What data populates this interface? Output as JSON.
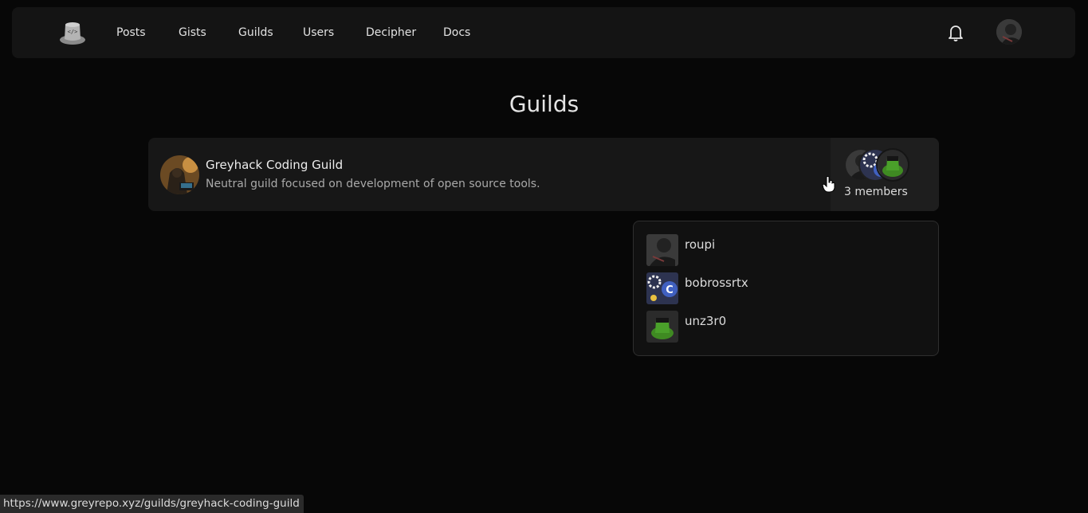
{
  "nav": {
    "links": [
      "Posts",
      "Gists",
      "Guilds",
      "Users",
      "Decipher",
      "Docs"
    ],
    "logo_icon": "hat-logo-icon",
    "bell_icon": "bell-icon"
  },
  "page": {
    "title": "Guilds"
  },
  "guild": {
    "name": "Greyhack Coding Guild",
    "description": "Neutral guild focused on development of open source tools.",
    "members_label": "3 members"
  },
  "members": [
    {
      "name": "roupi"
    },
    {
      "name": "bobrossrtx"
    },
    {
      "name": "unz3r0"
    }
  ],
  "status_bar": {
    "url": "https://www.greyrepo.xyz/guilds/greyhack-coding-guild"
  },
  "colors": {
    "background": "#070707",
    "navbar": "#141414",
    "card": "#171717",
    "accent_green": "#3f8a22"
  }
}
